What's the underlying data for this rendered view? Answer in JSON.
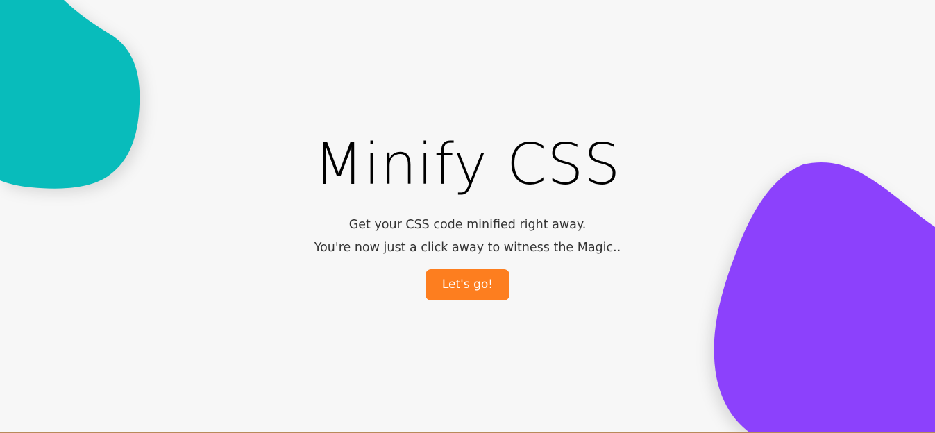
{
  "hero": {
    "title": "Minify CSS",
    "line1": "Get your CSS code minified right away.",
    "line2": "You're now just a click away to witness the Magic..",
    "cta_label": "Let's go!"
  },
  "colors": {
    "background": "#f7f7f7",
    "teal_blob": "#08bcbb",
    "purple_blob": "#8c41fc",
    "cta": "#fd7e1f"
  }
}
